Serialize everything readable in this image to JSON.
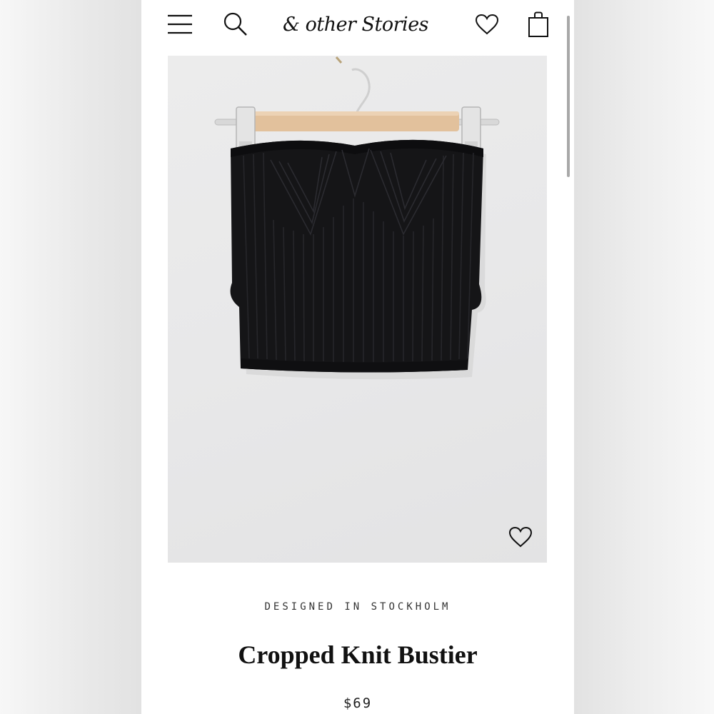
{
  "header": {
    "brand": "& other Stories",
    "menu_icon": "hamburger-menu-icon",
    "search_icon": "search-icon",
    "wishlist_icon": "heart-icon",
    "bag_icon": "shopping-bag-icon"
  },
  "product": {
    "tagline": "DESIGNED IN STOCKHOLM",
    "name": "Cropped Knit Bustier",
    "price": "$69",
    "image_wishlist_icon": "heart-icon"
  },
  "colors": {
    "text": "#111111",
    "image_background": "#e8e8e9",
    "garment": "#141416"
  }
}
